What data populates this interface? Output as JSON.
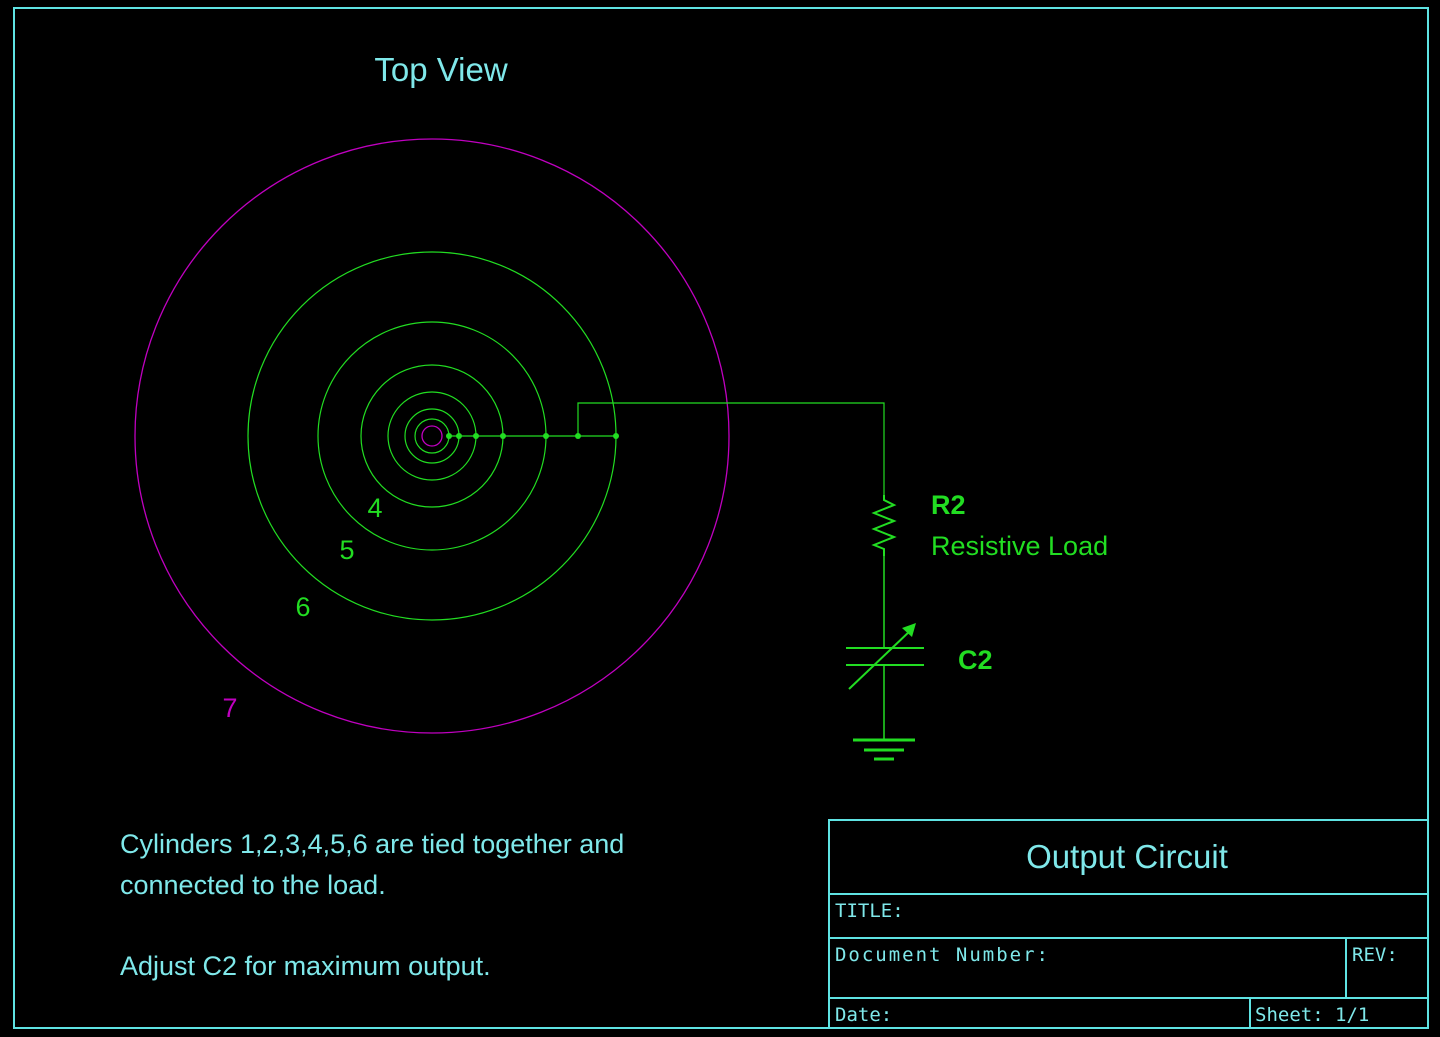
{
  "colors": {
    "background": "#000000",
    "frame": "#5fe3e3",
    "text_cyan": "#7fe8ea",
    "circuit_green": "#22dd22",
    "outer_magenta": "#c000c0"
  },
  "top_view": {
    "title": "Top View",
    "cylinder_labels": {
      "c4": "4",
      "c5": "5",
      "c6": "6",
      "c7": "7"
    }
  },
  "circuit": {
    "resistor": {
      "ref": "R2",
      "description": "Resistive Load"
    },
    "capacitor": {
      "ref": "C2"
    }
  },
  "notes": {
    "line1": "Cylinders 1,2,3,4,5,6 are tied together and",
    "line2": "connected to the load.",
    "line3": "Adjust C2 for maximum output."
  },
  "title_block": {
    "heading": "Output Circuit",
    "title_label": "TITLE:",
    "doc_number_label": "Document Number:",
    "rev_label": "REV:",
    "date_label": "Date:",
    "sheet_label": "Sheet:",
    "sheet_value": "1/1"
  }
}
